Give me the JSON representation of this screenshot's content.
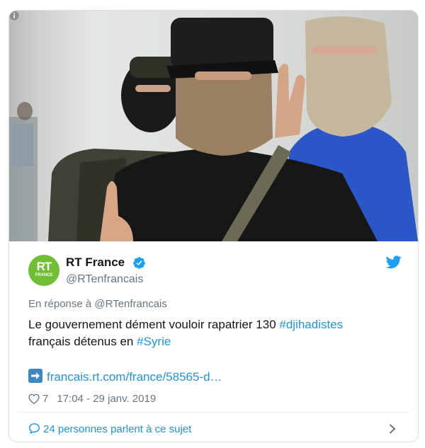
{
  "author": {
    "name": "RT France",
    "handle": "@RTenfrancais",
    "avatar_text": "RT",
    "avatar_subtext": "FRANCE"
  },
  "reply_context": "En réponse à @RTenfrancais",
  "tweet": {
    "text_part1": "Le gouvernement dément vouloir rapatrier 130 ",
    "hashtag1": "#djihadistes",
    "text_part2": "français détenus en ",
    "hashtag2": "#Syrie"
  },
  "link": "francais.rt.com/france/58565-d…",
  "likes_count": "7",
  "timestamp": "17:04 - 29 janv. 2019",
  "footer_label": "24 personnes parlent à ce sujet",
  "colors": {
    "avatar_green": "#6fbe33",
    "link_blue": "#1b95e0",
    "muted_gray": "#657786",
    "verified_blue": "#1da1f2"
  },
  "icons": [
    "info-icon",
    "verified-icon",
    "twitter-bird-icon",
    "link-arrow-icon",
    "heart-icon",
    "speech-bubble-icon",
    "chevron-right-icon"
  ]
}
